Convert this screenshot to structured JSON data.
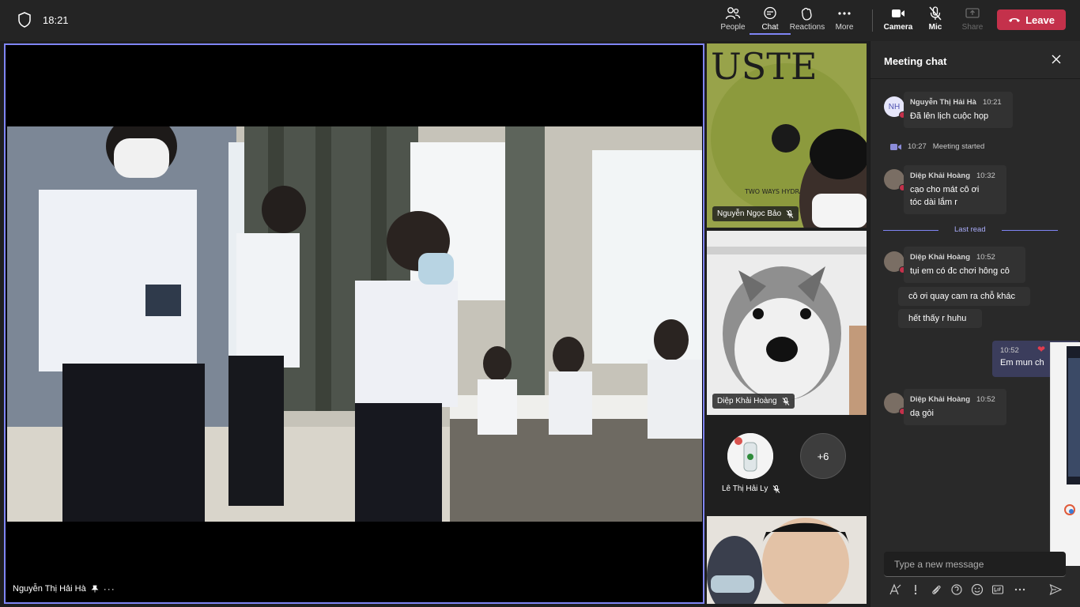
{
  "topbar": {
    "time": "18:21",
    "buttons": {
      "people": "People",
      "chat": "Chat",
      "reactions": "Reactions",
      "more": "More",
      "camera": "Camera",
      "mic": "Mic",
      "share": "Share"
    },
    "leave": "Leave",
    "leave_color": "#c4314b",
    "accent": "#7f85f5"
  },
  "main_video": {
    "participant": "Nguyễn Thị Hải Hà",
    "icons": [
      "pin-icon",
      "more-options-icon"
    ]
  },
  "participants": [
    {
      "name": "Nguyễn Ngọc Bảo",
      "muted": true,
      "video_text": "USTE",
      "video_caption": "TWO WAYS HYDRA"
    },
    {
      "name": "Diệp Khải Hoàng",
      "muted": true
    },
    {
      "name": "Lê Thị Hải Ly",
      "muted": true
    }
  ],
  "more_participants": "+6",
  "chat": {
    "title": "Meeting chat",
    "messages": [
      {
        "initials": "NH",
        "author": "Nguyễn Thị Hải Hà",
        "time": "10:21",
        "lines": [
          "Đã lên lịch cuộc họp"
        ]
      },
      {
        "author": "Diệp Khải Hoàng",
        "time": "10:32",
        "lines": [
          "cạo cho mát cô ơi",
          "tóc dài lắm r"
        ]
      },
      {
        "author": "Diệp Khải Hoàng",
        "time": "10:52",
        "lines": [
          "tụi em có đc chơi hông cô"
        ]
      },
      {
        "lines": [
          "cô ơi quay cam ra chỗ khác"
        ]
      },
      {
        "lines": [
          "hết thấy r huhu"
        ]
      },
      {
        "author": "Diệp Khải Hoàng",
        "time": "10:52",
        "lines": [
          "dạ gòi"
        ]
      }
    ],
    "system": {
      "time": "10:27",
      "text": "Meeting started"
    },
    "last_read": "Last read",
    "my_message": {
      "time": "10:52",
      "text": "Em mun ch"
    },
    "compose_placeholder": "Type a new message"
  }
}
